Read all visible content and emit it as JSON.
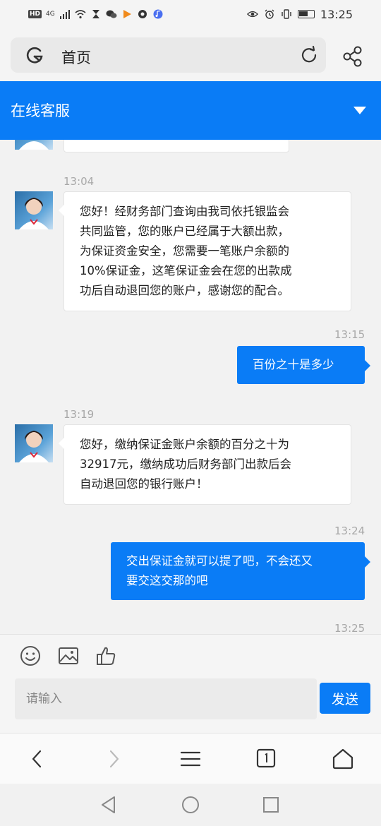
{
  "status_bar": {
    "network_badge": "HD",
    "signal": "4G",
    "time": "13:25"
  },
  "browser": {
    "address_text": "首页",
    "icons": {
      "logo": "browser-logo-icon",
      "refresh": "refresh-icon",
      "share": "share-icon"
    }
  },
  "chat": {
    "header_title": "在线客服",
    "messages": [
      {
        "time": "13:04",
        "side": "left",
        "text": "您好！经财务部门查询由我司依托银监会\n共同监管，您的账户已经属于大额出款，\n为保证资金安全，您需要一笔账户余额的\n10%保证金，这笔保证金会在您的出款成\n功后自动退回您的账户，感谢您的配合。"
      },
      {
        "time": "13:15",
        "side": "right",
        "text": "百份之十是多少"
      },
      {
        "time": "13:19",
        "side": "left",
        "text": "您好，缴纳保证金账户余额的百分之十为\n32917元，缴纳成功后财务部门出款后会\n自动退回您的银行账户！"
      },
      {
        "time": "13:24",
        "side": "right",
        "text": "交出保证金就可以提了吧，不会还又\n要交这交那的吧"
      },
      {
        "time": "13:25",
        "side": "left",
        "text": ""
      }
    ]
  },
  "input": {
    "placeholder": "请输入",
    "value": "",
    "send_label": "发送"
  },
  "colors": {
    "accent": "#0a7cf6",
    "background": "#f2f2f2"
  }
}
